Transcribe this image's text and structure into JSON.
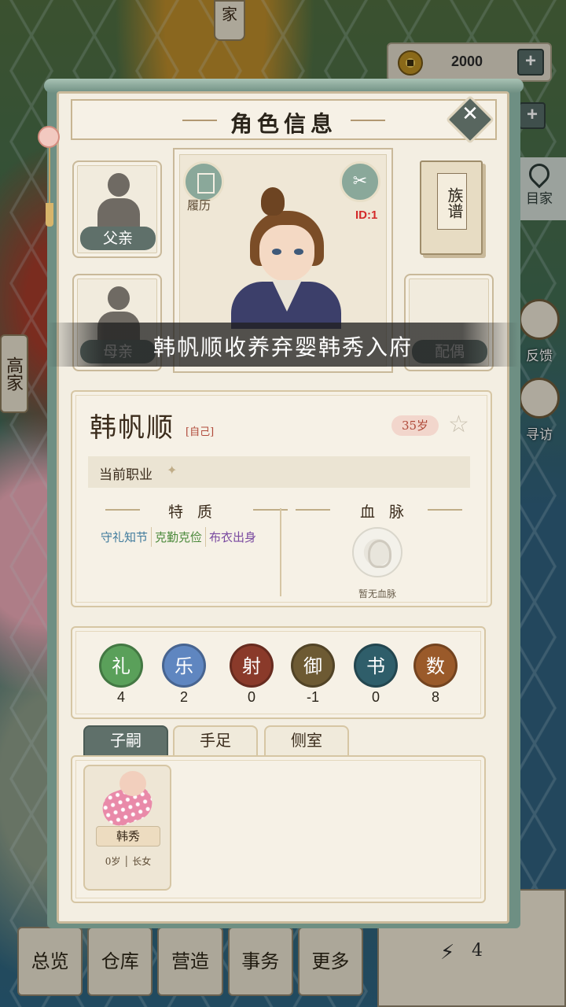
{
  "hud": {
    "coins": "2000",
    "top_tag": "家",
    "left_tag": "高家",
    "map_label": "目家",
    "feedback_label": "反馈",
    "visit_label": "寻访",
    "energy": "4"
  },
  "bottom_nav": [
    "总览",
    "仓库",
    "营造",
    "事务",
    "更多"
  ],
  "panel": {
    "title": "角色信息",
    "father_label": "父亲",
    "mother_label": "母亲",
    "spouse_label": "配偶",
    "genealogy_label": "族谱",
    "resume_label": "履历",
    "id_label": "ID:1"
  },
  "banner": "韩帆顺收养弃婴韩秀入府",
  "character": {
    "name": "韩帆顺",
    "self_tag": "[自己]",
    "age": "35岁",
    "job_label": "当前职业",
    "traits_title": "特 质",
    "bloodline_title": "血 脉",
    "traits": [
      {
        "text": "守礼知节",
        "color": "#3f7a9c"
      },
      {
        "text": "克勤克俭",
        "color": "#4c8a3c"
      },
      {
        "text": "布衣出身",
        "color": "#7a4aa0"
      }
    ],
    "no_bloodline": "暂无血脉"
  },
  "skills": [
    {
      "name": "礼",
      "value": "4",
      "color": "#5aa05a"
    },
    {
      "name": "乐",
      "value": "2",
      "color": "#5f86c0"
    },
    {
      "name": "射",
      "value": "0",
      "color": "#8a3a2a"
    },
    {
      "name": "御",
      "value": "-1",
      "color": "#6d5a33"
    },
    {
      "name": "书",
      "value": "0",
      "color": "#2f5e6a"
    },
    {
      "name": "数",
      "value": "8",
      "color": "#9a5a2a"
    }
  ],
  "tabs": [
    "子嗣",
    "手足",
    "侧室"
  ],
  "children": [
    {
      "name": "韩秀",
      "age": "0岁",
      "rank": "长女"
    }
  ]
}
